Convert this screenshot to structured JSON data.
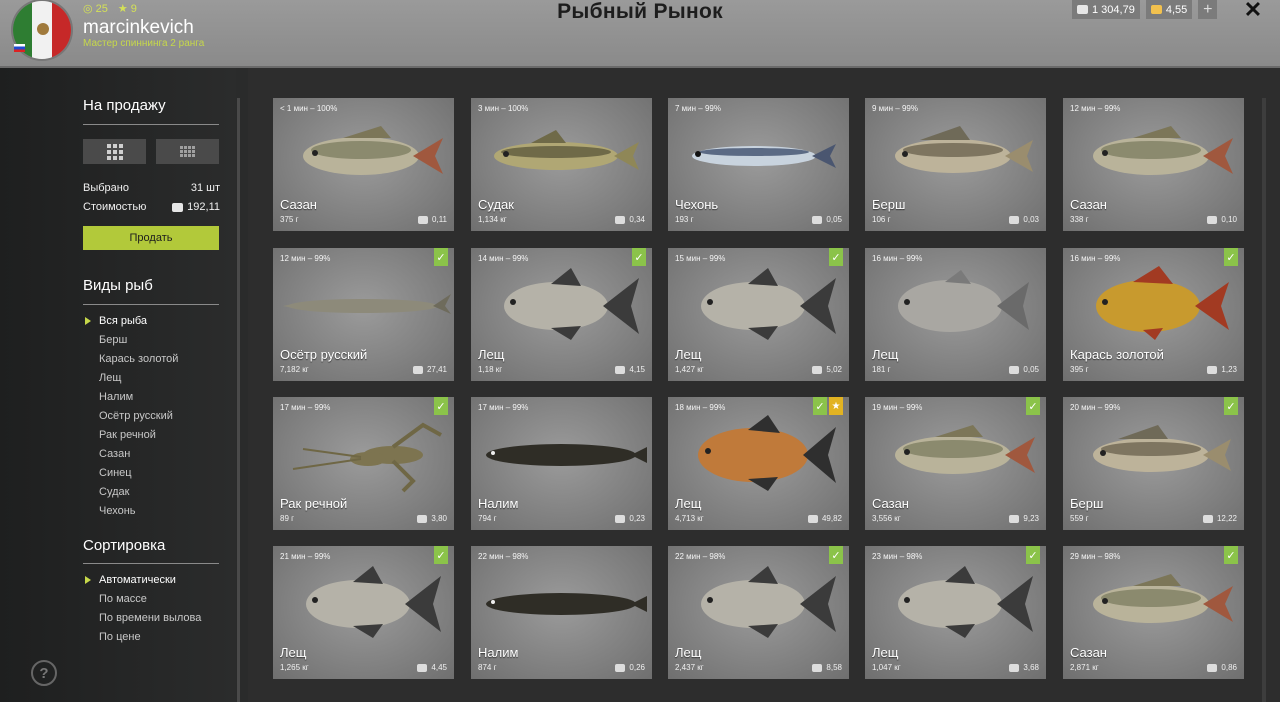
{
  "header": {
    "level": "25",
    "stars": "9",
    "username": "marcinkevich",
    "rank": "Мастер спиннинга 2 ранга",
    "title": "Рыбный Рынок",
    "silver": "1 304,79",
    "gold": "4,55",
    "plus": "+",
    "close": "✕"
  },
  "sidebar": {
    "sale_title": "На продажу",
    "selected_label": "Выбрано",
    "selected_value": "31 шт",
    "cost_label": "Стоимостью",
    "cost_value": "192,11",
    "sell_button": "Продать",
    "species_title": "Виды рыб",
    "species": [
      "Вся рыба",
      "Берш",
      "Карась золотой",
      "Лещ",
      "Налим",
      "Осётр русский",
      "Рак речной",
      "Сазан",
      "Синец",
      "Судак",
      "Чехонь"
    ],
    "sort_title": "Сортировка",
    "sort_options": [
      "Автоматически",
      "По массе",
      "По времени вылова",
      "По цене"
    ],
    "help": "?"
  },
  "cards": [
    {
      "time": "< 1 мин – 100%",
      "name": "Сазан",
      "weight": "375 г",
      "price": "0,11",
      "check": false,
      "star": false,
      "fish": "carp"
    },
    {
      "time": "3 мин – 100%",
      "name": "Судак",
      "weight": "1,134 кг",
      "price": "0,34",
      "check": false,
      "star": false,
      "fish": "zander"
    },
    {
      "time": "7 мин – 99%",
      "name": "Чехонь",
      "weight": "193 г",
      "price": "0,05",
      "check": false,
      "star": false,
      "fish": "sabre"
    },
    {
      "time": "9 мин – 99%",
      "name": "Берш",
      "weight": "106 г",
      "price": "0,03",
      "check": false,
      "star": false,
      "fish": "bersh"
    },
    {
      "time": "12 мин – 99%",
      "name": "Сазан",
      "weight": "338 г",
      "price": "0,10",
      "check": false,
      "star": false,
      "fish": "carp"
    },
    {
      "time": "12 мин – 99%",
      "name": "Осётр русский",
      "weight": "7,182 кг",
      "price": "27,41",
      "check": true,
      "star": false,
      "fish": "sturgeon"
    },
    {
      "time": "14 мин – 99%",
      "name": "Лещ",
      "weight": "1,18 кг",
      "price": "4,15",
      "check": true,
      "star": false,
      "fish": "bream"
    },
    {
      "time": "15 мин – 99%",
      "name": "Лещ",
      "weight": "1,427 кг",
      "price": "5,02",
      "check": true,
      "star": false,
      "fish": "bream"
    },
    {
      "time": "16 мин – 99%",
      "name": "Лещ",
      "weight": "181 г",
      "price": "0,05",
      "check": false,
      "star": false,
      "fish": "breamsmall"
    },
    {
      "time": "16 мин – 99%",
      "name": "Карась золотой",
      "weight": "395 г",
      "price": "1,23",
      "check": true,
      "star": false,
      "fish": "goldcarp"
    },
    {
      "time": "17 мин – 99%",
      "name": "Рак речной",
      "weight": "89 г",
      "price": "3,80",
      "check": true,
      "star": false,
      "fish": "crayfish"
    },
    {
      "time": "17 мин – 99%",
      "name": "Налим",
      "weight": "794 г",
      "price": "0,23",
      "check": false,
      "star": false,
      "fish": "burbot"
    },
    {
      "time": "18 мин – 99%",
      "name": "Лещ",
      "weight": "4,713 кг",
      "price": "49,82",
      "check": true,
      "star": true,
      "fish": "breamgold"
    },
    {
      "time": "19 мин – 99%",
      "name": "Сазан",
      "weight": "3,556 кг",
      "price": "9,23",
      "check": true,
      "star": false,
      "fish": "carp"
    },
    {
      "time": "20 мин – 99%",
      "name": "Берш",
      "weight": "559 г",
      "price": "12,22",
      "check": true,
      "star": false,
      "fish": "bersh"
    },
    {
      "time": "21 мин – 99%",
      "name": "Лещ",
      "weight": "1,265 кг",
      "price": "4,45",
      "check": true,
      "star": false,
      "fish": "bream"
    },
    {
      "time": "22 мин – 98%",
      "name": "Налим",
      "weight": "874 г",
      "price": "0,26",
      "check": false,
      "star": false,
      "fish": "burbot"
    },
    {
      "time": "22 мин – 98%",
      "name": "Лещ",
      "weight": "2,437 кг",
      "price": "8,58",
      "check": true,
      "star": false,
      "fish": "bream"
    },
    {
      "time": "23 мин – 98%",
      "name": "Лещ",
      "weight": "1,047 кг",
      "price": "3,68",
      "check": true,
      "star": false,
      "fish": "bream"
    },
    {
      "time": "29 мин – 98%",
      "name": "Сазан",
      "weight": "2,871 кг",
      "price": "0,86",
      "check": true,
      "star": false,
      "fish": "carp"
    }
  ],
  "check_glyph": "✓",
  "star_glyph": "★"
}
